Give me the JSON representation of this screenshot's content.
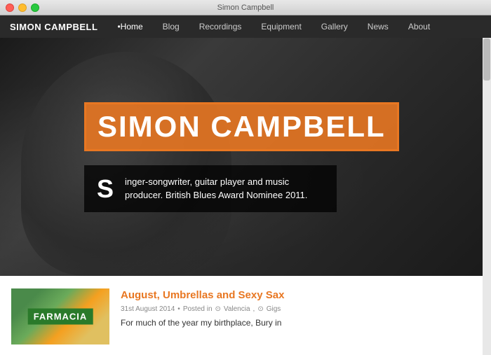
{
  "window": {
    "title": "Simon Campbell"
  },
  "navbar": {
    "brand": "SIMON CAMPBELL",
    "items": [
      {
        "label": "Home",
        "active": true
      },
      {
        "label": "Blog",
        "active": false
      },
      {
        "label": "Recordings",
        "active": false
      },
      {
        "label": "Equipment",
        "active": false
      },
      {
        "label": "Gallery",
        "active": false
      },
      {
        "label": "News",
        "active": false
      },
      {
        "label": "About",
        "active": false
      }
    ]
  },
  "hero": {
    "title": "SIMON CAMPBELL",
    "s_letter": "S",
    "subtitle": "inger-songwriter, guitar player and music producer. British Blues Award Nominee 2011."
  },
  "post": {
    "title": "August, Umbrellas and Sexy Sax",
    "date": "31st August 2014",
    "meta_prefix": "Posted in",
    "location": "Valencia",
    "category": "Gigs",
    "excerpt": "For much of the year my birthplace, Bury in",
    "image_text": "FARMACIA"
  }
}
